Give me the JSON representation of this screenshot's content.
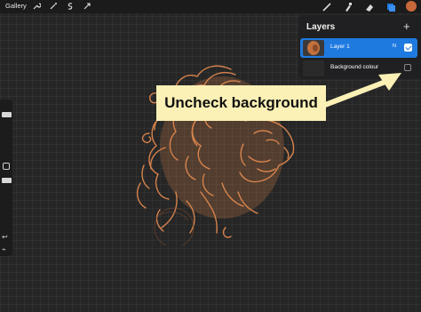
{
  "toolbar": {
    "gallery_label": "Gallery",
    "left_tools": [
      "wrench-icon",
      "magic-wand-icon",
      "selection-icon",
      "transform-arrow-icon"
    ],
    "right_tools": [
      "brush-icon",
      "smudge-icon",
      "eraser-icon",
      "layers-icon",
      "color-swatch"
    ],
    "active_color": "#c8683a"
  },
  "layers": {
    "title": "Layers",
    "add_symbol": "+",
    "items": [
      {
        "name": "Layer 1",
        "blend_mode": "N",
        "visible": true,
        "selected": true
      },
      {
        "name": "Background colour",
        "blend_mode": "",
        "visible": false,
        "selected": false
      }
    ]
  },
  "annotation": {
    "text": "Uncheck background",
    "color": "#fbf0b5"
  },
  "canvas": {
    "artwork": "lion-head-illustration",
    "art_color": "#d7834c"
  },
  "sidebar": {
    "icons": [
      "modify-square-icon",
      "undo-icon",
      "redo-icon"
    ]
  }
}
